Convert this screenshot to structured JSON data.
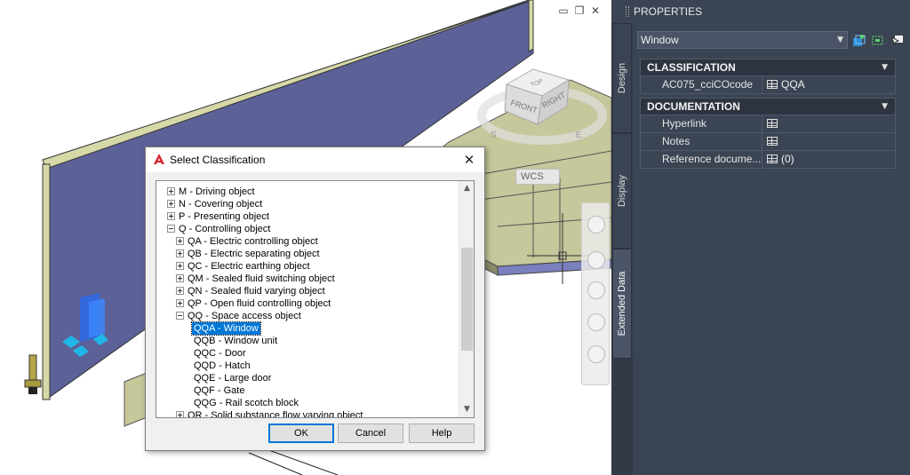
{
  "viewport": {
    "viewcube": {
      "top": "TOP",
      "front": "FRONT",
      "right": "RIGHT",
      "compass_s": "S",
      "compass_e": "E"
    },
    "wcs_label": "WCS"
  },
  "dialog": {
    "title": "Select Classification",
    "tree": [
      {
        "label": "M - Driving object",
        "level": 1,
        "expander": "plus"
      },
      {
        "label": "N - Covering object",
        "level": 1,
        "expander": "plus"
      },
      {
        "label": "P - Presenting object",
        "level": 1,
        "expander": "plus"
      },
      {
        "label": "Q - Controlling object",
        "level": 1,
        "expander": "minus"
      },
      {
        "label": "QA - Electric controlling object",
        "level": 2,
        "expander": "plus"
      },
      {
        "label": "QB - Electric separating object",
        "level": 2,
        "expander": "plus"
      },
      {
        "label": "QC - Electric earthing object",
        "level": 2,
        "expander": "plus"
      },
      {
        "label": "QM - Sealed fluid switching object",
        "level": 2,
        "expander": "plus"
      },
      {
        "label": "QN - Sealed fluid varying object",
        "level": 2,
        "expander": "plus"
      },
      {
        "label": "QP - Open fluid controlling object",
        "level": 2,
        "expander": "plus"
      },
      {
        "label": "QQ - Space access object",
        "level": 2,
        "expander": "minus"
      },
      {
        "label": "QQA - Window",
        "level": 3,
        "expander": "none",
        "selected": true
      },
      {
        "label": "QQB - Window unit",
        "level": 3,
        "expander": "none"
      },
      {
        "label": "QQC - Door",
        "level": 3,
        "expander": "none"
      },
      {
        "label": "QQD - Hatch",
        "level": 3,
        "expander": "none"
      },
      {
        "label": "QQE - Large door",
        "level": 3,
        "expander": "none"
      },
      {
        "label": "QQF - Gate",
        "level": 3,
        "expander": "none"
      },
      {
        "label": "QQG - Rail scotch block",
        "level": 3,
        "expander": "none"
      },
      {
        "label": "QR - Solid substance flow varying object",
        "level": 2,
        "expander": "plus"
      }
    ],
    "buttons": {
      "ok": "OK",
      "cancel": "Cancel",
      "help": "Help"
    }
  },
  "properties": {
    "header": "PROPERTIES",
    "tabs": {
      "design": "Design",
      "display": "Display",
      "extended": "Extended Data"
    },
    "object_type": "Window",
    "classification": {
      "title": "CLASSIFICATION",
      "rows": [
        {
          "name": "AC075_cciCOcode",
          "value": "QQA"
        }
      ]
    },
    "documentation": {
      "title": "DOCUMENTATION",
      "rows": [
        {
          "name": "Hyperlink",
          "value": ""
        },
        {
          "name": "Notes",
          "value": ""
        },
        {
          "name": "Reference docume...",
          "value": "(0)"
        }
      ]
    }
  },
  "colors": {
    "wall_face": "#5c6298",
    "wall_edge": "#d7d8a8",
    "floor": "#c6c79b",
    "floor_side": "#7a7fbd",
    "panel_bg": "#3b4453",
    "selection": "#0078d7"
  }
}
